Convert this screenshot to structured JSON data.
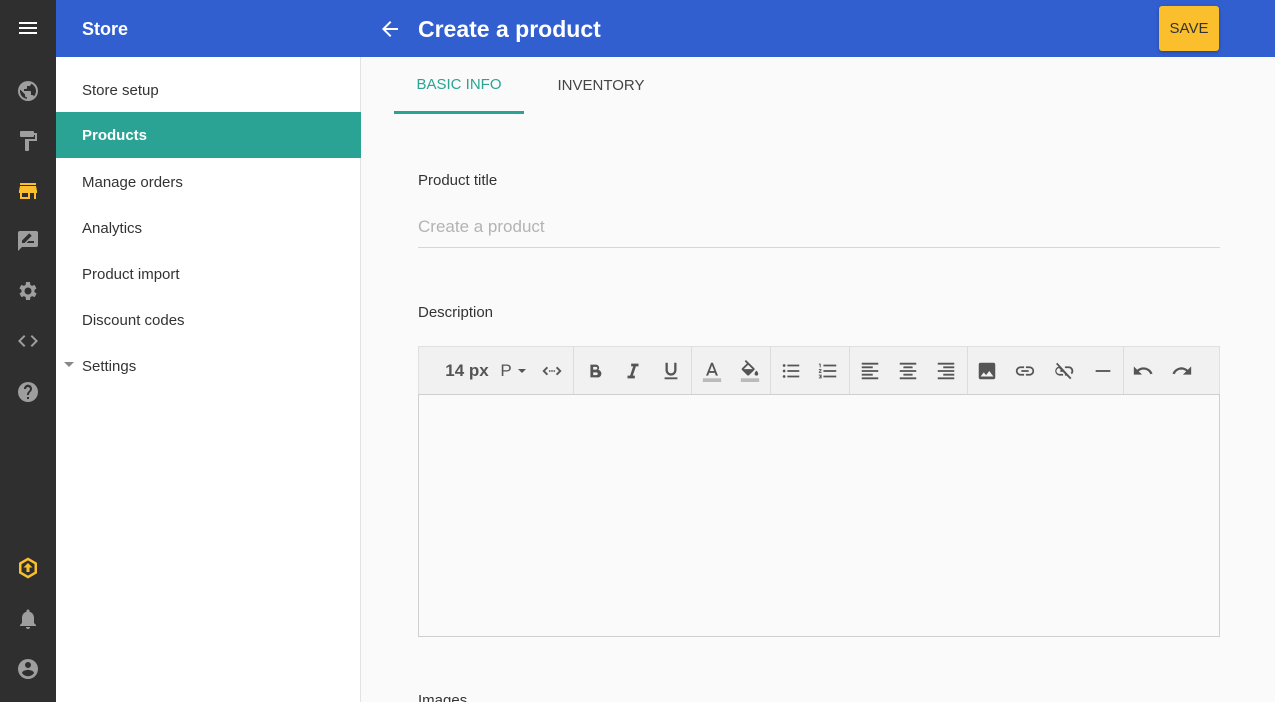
{
  "rail": {
    "icons": [
      "menu-icon",
      "globe-icon",
      "paint-roller-icon",
      "store-icon",
      "feedback-icon",
      "gear-icon",
      "code-icon",
      "help-icon",
      "upgrade-icon",
      "bell-icon",
      "account-icon"
    ],
    "active_color": "#fbbf2d"
  },
  "sidebar": {
    "title": "Store",
    "items": [
      {
        "label": "Store setup"
      },
      {
        "label": "Products"
      },
      {
        "label": "Manage orders"
      },
      {
        "label": "Analytics"
      },
      {
        "label": "Product import"
      },
      {
        "label": "Discount codes"
      },
      {
        "label": "Settings"
      }
    ],
    "active_index": 1
  },
  "header": {
    "title": "Create a product",
    "save_label": "SAVE"
  },
  "tabs": [
    {
      "label": "BASIC INFO",
      "active": true
    },
    {
      "label": "INVENTORY",
      "active": false
    }
  ],
  "form": {
    "product_title_label": "Product title",
    "product_title_placeholder": "Create a product",
    "product_title_value": "",
    "description_label": "Description",
    "images_label": "Images"
  },
  "editor_toolbar": {
    "font_size": "14 px",
    "paragraph": "P"
  },
  "colors": {
    "header_blue": "#315fcf",
    "accent_teal": "#2ba394",
    "save_yellow": "#fbbf2d",
    "rail_dark": "#2f2f2f"
  }
}
